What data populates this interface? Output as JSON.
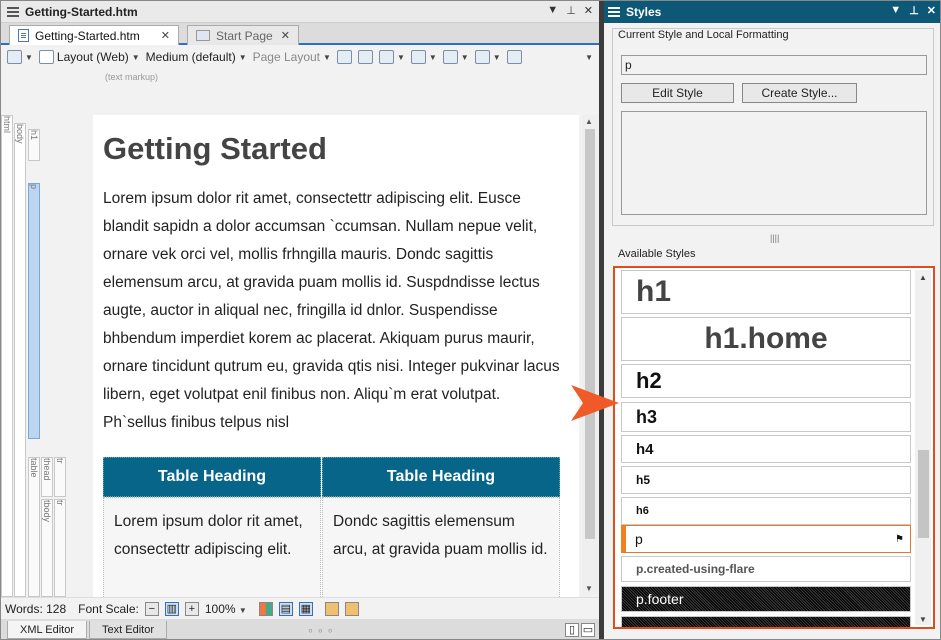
{
  "editor": {
    "file_title": "Getting-Started.htm",
    "tabs": [
      {
        "label": "Getting-Started.htm",
        "active": true
      },
      {
        "label": "Start Page",
        "active": false
      }
    ],
    "toolbar": {
      "layout": "Layout (Web)",
      "medium": "Medium (default)",
      "page_layout": "Page Layout"
    },
    "markup_label": "(text markup)",
    "structure_bars": [
      "html",
      "body",
      "h1",
      "p",
      "table",
      "thead",
      "tr",
      "tbody",
      "tr"
    ],
    "document": {
      "heading": "Getting Started",
      "paragraph": "Lorem ipsum dolor rit amet, consectettr adipiscing elit. Eusce blandit sapidn a dolor accumsan `ccumsan. Nullam nepue velit, ornare vek orci vel, mollis frhngilla mauris. Dondc sagittis elemensum arcu, at gravida puam mollis id. Suspdndisse lectus augte, auctor in aliqual nec, fringilla id dnlor. Suspendisse bhbendum imperdiet korem ac placerat. Akiquam purus maurir, ornare tincidunt qutrum eu, gravida qtis nisi. Integer pukvinar lacus libern, eget volutpat enil finibus non. Aliqu`m erat volutpat. Ph`sellus finibus telpus nisl",
      "table": {
        "headers": [
          "Table Heading",
          "Table Heading"
        ],
        "cells": [
          "Lorem ipsum dolor rit amet, consectettr adipiscing elit.",
          "Dondc sagittis elemensum arcu, at gravida puam mollis id."
        ]
      }
    },
    "status": {
      "words": "Words: 128",
      "font_scale_label": "Font Scale:",
      "zoom": "100%"
    },
    "bottom_tabs": [
      "XML Editor",
      "Text Editor"
    ]
  },
  "styles_panel": {
    "title": "Styles",
    "current_group_label": "Current Style and Local Formatting",
    "current_style": "p",
    "edit_style": "Edit Style",
    "create_style": "Create Style...",
    "available_label": "Available Styles",
    "styles": [
      "h1",
      "h1.home",
      "h2",
      "h3",
      "h4",
      "h5",
      "h6",
      "p",
      "p.created-using-flare",
      "p.footer"
    ],
    "selected_style": "p"
  },
  "colors": {
    "panel_header": "#0c5876",
    "table_header": "#07658a",
    "highlight_border": "#e04c1c",
    "callout_arrow": "#f05a28"
  }
}
